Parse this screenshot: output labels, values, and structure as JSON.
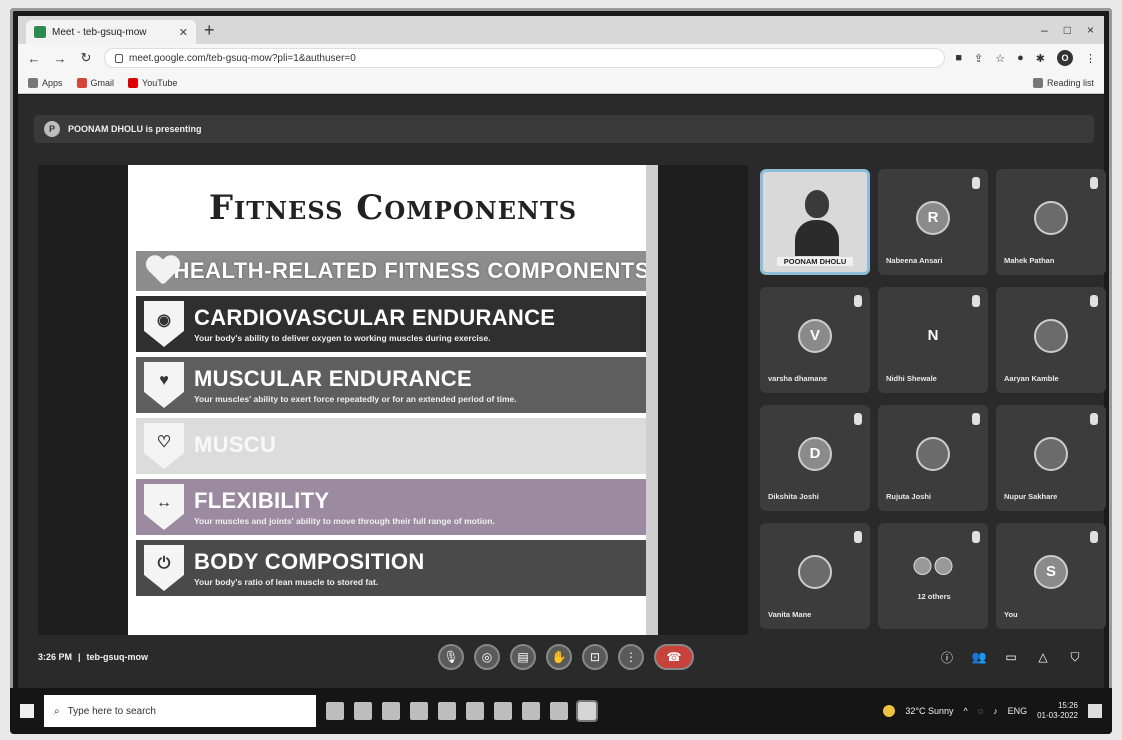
{
  "browser": {
    "tab_title": "Meet - teb-gsuq-mow",
    "new_tab": "+",
    "url": "meet.google.com/teb-gsuq-mow?pli=1&authuser=0",
    "window_controls": [
      "–",
      "□",
      "×"
    ],
    "bookmarks": [
      {
        "label": "Apps",
        "icon": "apps-grid-icon"
      },
      {
        "label": "Gmail",
        "icon": "gmail-icon"
      },
      {
        "label": "YouTube",
        "icon": "youtube-icon"
      }
    ],
    "reading_list": "Reading list"
  },
  "meet": {
    "presenting_text": "POONAM DHOLU is presenting",
    "time": "3:26 PM",
    "separator": "|",
    "meeting_code": "teb-gsuq-mow"
  },
  "slide": {
    "title": "Fitness Components",
    "banner": "HEALTH-RELATED FITNESS COMPONENTS",
    "components": [
      {
        "title": "CARDIOVASCULAR ENDURANCE",
        "desc": "Your body's ability to deliver oxygen to working muscles during exercise."
      },
      {
        "title": "MUSCULAR ENDURANCE",
        "desc": "Your muscles' ability to exert force repeatedly or for an extended period of time."
      },
      {
        "title": "MUSCU",
        "desc": ""
      },
      {
        "title": "FLEXIBILITY",
        "desc": "Your muscles and joints' ability to move through their full range of motion."
      },
      {
        "title": "BODY COMPOSITION",
        "desc": "Your body's ratio of lean muscle to stored fat."
      }
    ]
  },
  "participants": [
    {
      "name": "POONAM DHOLU",
      "initial": "",
      "type": "video"
    },
    {
      "name": "Nabeena Ansari",
      "initial": "R",
      "type": "initial"
    },
    {
      "name": "Mahek Pathan",
      "initial": "",
      "type": "photo"
    },
    {
      "name": "varsha dhamane",
      "initial": "V",
      "type": "initial"
    },
    {
      "name": "Nidhi Shewale",
      "initial": "N",
      "type": "initial"
    },
    {
      "name": "Aaryan Kamble",
      "initial": "",
      "type": "photo"
    },
    {
      "name": "Dikshita Joshi",
      "initial": "D",
      "type": "initial"
    },
    {
      "name": "Rujuta Joshi",
      "initial": "",
      "type": "photo"
    },
    {
      "name": "Nupur Sakhare",
      "initial": "",
      "type": "photo"
    },
    {
      "name": "Vanita Mane",
      "initial": "",
      "type": "photo"
    },
    {
      "name": "12 others",
      "initial": "",
      "type": "others"
    },
    {
      "name": "You",
      "initial": "S",
      "type": "initial"
    }
  ],
  "taskbar": {
    "search_placeholder": "Type here to search",
    "weather": "32°C Sunny",
    "lang": "ENG",
    "time": "15:26",
    "date": "01-03-2022"
  }
}
